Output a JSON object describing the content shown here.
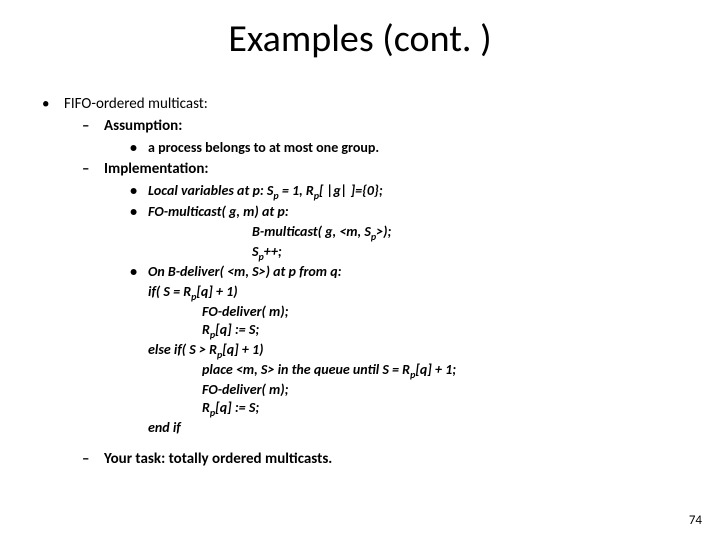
{
  "slide": {
    "title": "Examples (cont. )",
    "pageNumber": "74",
    "l1": "FIFO-ordered multicast:",
    "l2_assumption": "Assumption:",
    "l3_assumption_item": "a process belongs to at most one group.",
    "l2_implementation": "Implementation:",
    "impl": {
      "localvars_pre": "Local variables at p: S",
      "localvars_mid": " = 1, R",
      "localvars_post": "[ |g| ]={0};",
      "fomc_pre": "FO-multicast( g, m)",
      "fomc_post": " at p:",
      "bmc_pre": "B-multicast( g, <m, S",
      "bmc_post": ">);",
      "inc_pre": "S",
      "inc_post": "++;",
      "ondeliver_pre": "On B-deliver",
      "ondeliver_post": "( <m, S>) at p from q:",
      "if_pre": "if( S = R",
      "if_post": "[q] + 1)",
      "fodeliver": "FO-deliver( m);",
      "assign_pre": "R",
      "assign_post": "[q] := S;",
      "elseif_pre": "else if( S > R",
      "elseif_post": "[q] + 1)",
      "place_pre": "place <m, S> in the queue until S = R",
      "place_post": "[q] + 1;",
      "endif": "end if"
    },
    "l2_task": "Your task: totally ordered multicasts."
  }
}
